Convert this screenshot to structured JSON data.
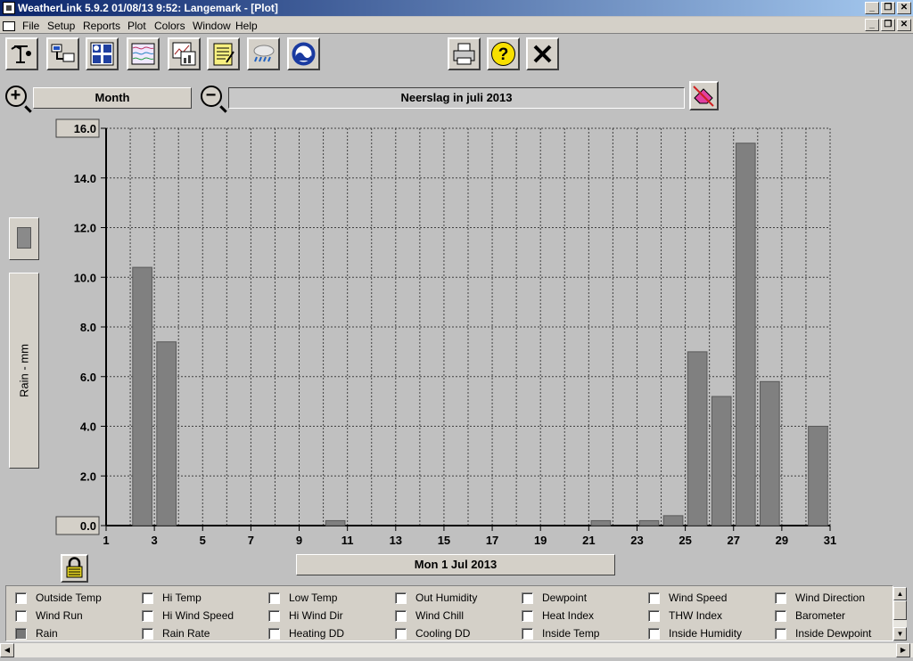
{
  "window": {
    "title": "WeatherLink 5.9.2  01/08/13  9:52: Langemark - [Plot]"
  },
  "menu": [
    "File",
    "Setup",
    "Reports",
    "Plot",
    "Colors",
    "Window",
    "Help"
  ],
  "toolbar": {
    "left_icons": [
      "station-icon",
      "download-icon",
      "bulletin-icon",
      "strip-chart-icon",
      "plot-icon",
      "summary-icon",
      "weather-icon",
      "noaa-icon"
    ],
    "right_icons": [
      "print-icon",
      "help-icon",
      "close-icon"
    ]
  },
  "range": {
    "span": "Month",
    "title": "Neerslag in juli 2013"
  },
  "axis_panel": {
    "ylabel": "Rain - mm"
  },
  "date_button": "Mon 1 Jul 2013",
  "chart_data": {
    "type": "bar",
    "title": "Neerslag in juli 2013",
    "ylabel": "Rain - mm",
    "xlabel": "",
    "ylim": [
      0,
      16
    ],
    "yticks": [
      "16.0",
      "14.0",
      "12.0",
      "10.0",
      "8.0",
      "6.0",
      "4.0",
      "2.0",
      "0.0"
    ],
    "xticks": [
      "1",
      "3",
      "5",
      "7",
      "9",
      "11",
      "13",
      "15",
      "17",
      "19",
      "21",
      "23",
      "25",
      "27",
      "29",
      "31"
    ],
    "grid": true,
    "bar_color": "#808080",
    "categories": [
      1,
      2,
      3,
      4,
      5,
      6,
      7,
      8,
      9,
      10,
      11,
      12,
      13,
      14,
      15,
      16,
      17,
      18,
      19,
      20,
      21,
      22,
      23,
      24,
      25,
      26,
      27,
      28,
      29,
      30,
      31
    ],
    "values": [
      0,
      10.4,
      7.4,
      0,
      0,
      0,
      0,
      0,
      0,
      0.2,
      0,
      0,
      0,
      0,
      0,
      0,
      0,
      0,
      0,
      0,
      0.2,
      0,
      0.2,
      0.4,
      7.0,
      5.2,
      15.4,
      5.8,
      0,
      4.0,
      0
    ]
  },
  "series_options": [
    {
      "label": "Outside Temp",
      "checked": false
    },
    {
      "label": "Hi Temp",
      "checked": false
    },
    {
      "label": "Low Temp",
      "checked": false
    },
    {
      "label": "Out Humidity",
      "checked": false
    },
    {
      "label": "Dewpoint",
      "checked": false
    },
    {
      "label": "Wind Speed",
      "checked": false
    },
    {
      "label": "Wind Direction",
      "checked": false
    },
    {
      "label": "Wind Run",
      "checked": false
    },
    {
      "label": "Hi Wind Speed",
      "checked": false
    },
    {
      "label": "Hi Wind Dir",
      "checked": false
    },
    {
      "label": "Wind Chill",
      "checked": false
    },
    {
      "label": "Heat Index",
      "checked": false
    },
    {
      "label": "THW Index",
      "checked": false
    },
    {
      "label": "Barometer",
      "checked": false
    },
    {
      "label": "Rain",
      "checked": true
    },
    {
      "label": "Rain Rate",
      "checked": false
    },
    {
      "label": "Heating DD",
      "checked": false
    },
    {
      "label": "Cooling DD",
      "checked": false
    },
    {
      "label": "Inside Temp",
      "checked": false
    },
    {
      "label": "Inside Humidity",
      "checked": false
    },
    {
      "label": "Inside Dewpoint",
      "checked": false
    }
  ]
}
